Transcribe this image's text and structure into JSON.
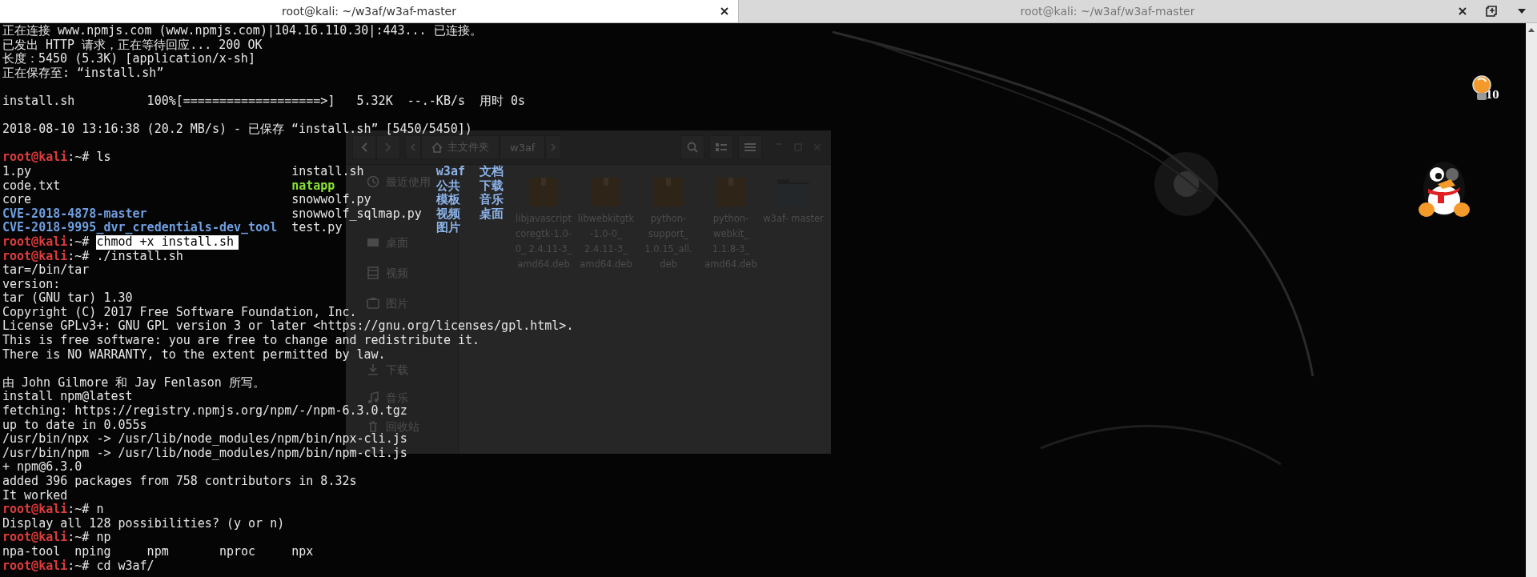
{
  "terminal": {
    "tabs": [
      {
        "title": "root@kali: ~/w3af/w3af-master",
        "selected": true
      },
      {
        "title": "root@kali: ~/w3af/w3af-master",
        "selected": false
      }
    ],
    "lines": [
      {
        "kind": "text",
        "text": "正在连接 www.npmjs.com (www.npmjs.com)|104.16.110.30|:443... 已连接。"
      },
      {
        "kind": "text",
        "text": "已发出 HTTP 请求，正在等待回应... 200 OK"
      },
      {
        "kind": "text",
        "text": "长度：5450 (5.3K) [application/x-sh]"
      },
      {
        "kind": "text",
        "text": "正在保存至: “install.sh”"
      },
      {
        "kind": "blank"
      },
      {
        "kind": "text",
        "text": "install.sh          100%[===================>]   5.32K  --.-KB/s  用时 0s"
      },
      {
        "kind": "blank"
      },
      {
        "kind": "text",
        "text": "2018-08-10 13:16:38 (20.2 MB/s) - 已保存 “install.sh” [5450/5450])"
      },
      {
        "kind": "blank"
      },
      {
        "kind": "prompt",
        "user_host": "root@kali",
        "tail": ":~#",
        "command": "ls",
        "selected": false
      },
      {
        "kind": "ls",
        "cells": [
          {
            "text": "1.py",
            "kind": "file"
          },
          {
            "text": "install.sh",
            "kind": "file"
          },
          {
            "text": "w3af",
            "kind": "dir"
          },
          {
            "text": "文档",
            "kind": "dir"
          }
        ]
      },
      {
        "kind": "ls",
        "cells": [
          {
            "text": "code.txt",
            "kind": "file"
          },
          {
            "text": "natapp",
            "kind": "exec"
          },
          {
            "text": "公共",
            "kind": "dir"
          },
          {
            "text": "下载",
            "kind": "dir"
          }
        ]
      },
      {
        "kind": "ls",
        "cells": [
          {
            "text": "core",
            "kind": "file"
          },
          {
            "text": "snowwolf.py",
            "kind": "file"
          },
          {
            "text": "模板",
            "kind": "dir"
          },
          {
            "text": "音乐",
            "kind": "dir"
          }
        ]
      },
      {
        "kind": "ls",
        "cells": [
          {
            "text": "CVE-2018-4878-master",
            "kind": "dir"
          },
          {
            "text": "snowwolf_sqlmap.py",
            "kind": "file"
          },
          {
            "text": "视频",
            "kind": "dir"
          },
          {
            "text": "桌面",
            "kind": "dir"
          }
        ]
      },
      {
        "kind": "ls",
        "cells": [
          {
            "text": "CVE-2018-9995_dvr_credentials-dev_tool",
            "kind": "dir"
          },
          {
            "text": "test.py",
            "kind": "file"
          },
          {
            "text": "图片",
            "kind": "dir"
          }
        ]
      },
      {
        "kind": "prompt",
        "user_host": "root@kali",
        "tail": ":~#",
        "command": "chmod +x install.sh",
        "selected": true
      },
      {
        "kind": "prompt",
        "user_host": "root@kali",
        "tail": ":~#",
        "command": "./install.sh",
        "selected": false
      },
      {
        "kind": "text",
        "text": "tar=/bin/tar"
      },
      {
        "kind": "text",
        "text": "version:"
      },
      {
        "kind": "text",
        "text": "tar (GNU tar) 1.30"
      },
      {
        "kind": "text",
        "text": "Copyright (C) 2017 Free Software Foundation, Inc."
      },
      {
        "kind": "text",
        "text": "License GPLv3+: GNU GPL version 3 or later <https://gnu.org/licenses/gpl.html>."
      },
      {
        "kind": "text",
        "text": "This is free software: you are free to change and redistribute it."
      },
      {
        "kind": "text",
        "text": "There is NO WARRANTY, to the extent permitted by law."
      },
      {
        "kind": "blank"
      },
      {
        "kind": "text",
        "text": "由 John Gilmore 和 Jay Fenlason 所写。"
      },
      {
        "kind": "text",
        "text": "install npm@latest"
      },
      {
        "kind": "text",
        "text": "fetching: https://registry.npmjs.org/npm/-/npm-6.3.0.tgz"
      },
      {
        "kind": "text",
        "text": "up to date in 0.055s"
      },
      {
        "kind": "text",
        "text": "/usr/bin/npx -> /usr/lib/node_modules/npm/bin/npx-cli.js"
      },
      {
        "kind": "text",
        "text": "/usr/bin/npm -> /usr/lib/node_modules/npm/bin/npm-cli.js"
      },
      {
        "kind": "text",
        "text": "+ npm@6.3.0"
      },
      {
        "kind": "text",
        "text": "added 396 packages from 758 contributors in 8.32s"
      },
      {
        "kind": "text",
        "text": "It worked"
      },
      {
        "kind": "prompt",
        "user_host": "root@kali",
        "tail": ":~#",
        "command": "n",
        "selected": false
      },
      {
        "kind": "text",
        "text": "Display all 128 possibilities? (y or n)"
      },
      {
        "kind": "prompt",
        "user_host": "root@kali",
        "tail": ":~#",
        "command": "np",
        "selected": false
      },
      {
        "kind": "text",
        "text": "npa-tool  nping     npm       nproc     npx"
      },
      {
        "kind": "prompt",
        "user_host": "root@kali",
        "tail": ":~#",
        "command": "cd w3af/",
        "selected": false
      }
    ]
  },
  "file_manager": {
    "breadcrumb": [
      {
        "label": "主文件夹",
        "kind": "home"
      },
      {
        "label": "w3af",
        "kind": "folder"
      }
    ],
    "sidebar": [
      {
        "label": "最近使用",
        "kind": "recent"
      },
      {
        "label": "桌面",
        "kind": "desktop"
      },
      {
        "label": "视频",
        "kind": "video"
      },
      {
        "label": "图片",
        "kind": "picture"
      },
      {
        "label": "下载",
        "kind": "download"
      },
      {
        "label": "音乐",
        "kind": "music"
      },
      {
        "label": "回收站",
        "kind": "trash"
      }
    ],
    "files": [
      {
        "name": "libjavascript coregtk-1.0-0_ 2.4.11-3_ amd64.deb",
        "kind": "package"
      },
      {
        "name": "libwebkitgtk -1.0-0_ 2.4.11-3_ amd64.deb",
        "kind": "package"
      },
      {
        "name": "python- support_ 1.0.15_all. deb",
        "kind": "package"
      },
      {
        "name": "python- webkit_ 1.1.8-3_ amd64.deb",
        "kind": "package"
      },
      {
        "name": "w3af- master",
        "kind": "folder"
      }
    ]
  },
  "desktop": {
    "icons": [
      {
        "kind": "bulb",
        "badge": "10"
      },
      {
        "kind": "penguin"
      }
    ]
  }
}
